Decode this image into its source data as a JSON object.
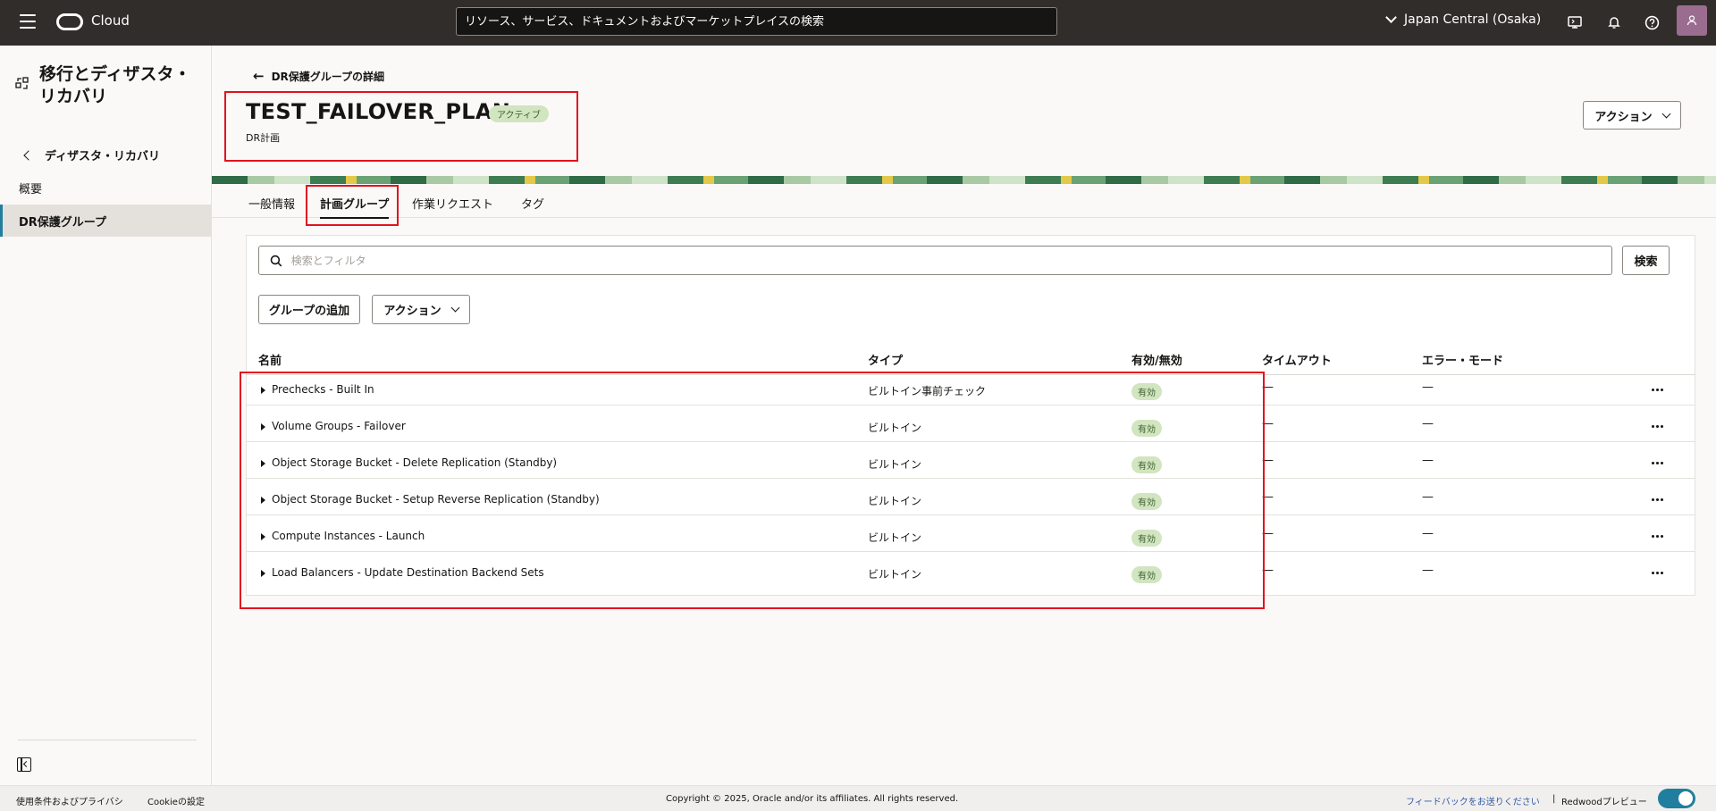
{
  "topbar": {
    "brand": "Cloud",
    "search_placeholder": "リソース、サービス、ドキュメントおよびマーケットプレイスの検索",
    "region": "Japan Central (Osaka)"
  },
  "sidebar": {
    "title": "移行とディザスタ・リカバリ",
    "back_label": "ディザスタ・リカバリ",
    "items": [
      {
        "label": "概要"
      },
      {
        "label": "DR保護グループ"
      }
    ]
  },
  "header": {
    "back_label": "DR保護グループの詳細",
    "title": "TEST_FAILOVER_PLAN",
    "status": "アクティブ",
    "subtitle": "DR計画",
    "actions_label": "アクション"
  },
  "tabs": [
    {
      "label": "一般情報"
    },
    {
      "label": "計画グループ"
    },
    {
      "label": "作業リクエスト"
    },
    {
      "label": "タグ"
    }
  ],
  "toolbar": {
    "filter_placeholder": "検索とフィルタ",
    "search_label": "検索",
    "add_label": "グループの追加",
    "actions_label": "アクション"
  },
  "table": {
    "columns": [
      "名前",
      "タイプ",
      "有効/無効",
      "タイムアウト",
      "エラー・モード"
    ],
    "rows": [
      {
        "name": "Prechecks - Built In",
        "type": "ビルトイン事前チェック",
        "enabled": "有効",
        "timeout": "—",
        "error_mode": "—"
      },
      {
        "name": "Volume Groups - Failover",
        "type": "ビルトイン",
        "enabled": "有効",
        "timeout": "—",
        "error_mode": "—"
      },
      {
        "name": "Object Storage Bucket - Delete Replication (Standby)",
        "type": "ビルトイン",
        "enabled": "有効",
        "timeout": "—",
        "error_mode": "—"
      },
      {
        "name": "Object Storage Bucket - Setup Reverse Replication (Standby)",
        "type": "ビルトイン",
        "enabled": "有効",
        "timeout": "—",
        "error_mode": "—"
      },
      {
        "name": "Compute Instances - Launch",
        "type": "ビルトイン",
        "enabled": "有効",
        "timeout": "—",
        "error_mode": "—"
      },
      {
        "name": "Load Balancers - Update Destination Backend Sets",
        "type": "ビルトイン",
        "enabled": "有効",
        "timeout": "—",
        "error_mode": "—"
      }
    ]
  },
  "footer": {
    "terms": "使用条件およびプライバシ",
    "cookie": "Cookieの設定",
    "copyright": "Copyright © 2025, Oracle and/or its affiliates. All rights reserved.",
    "feedback": "フィードバックをお送りください",
    "separator": "|",
    "redwood": "Redwoodプレビュー"
  },
  "colors": {
    "topbar": "#312d2a",
    "accent": "#227e9e",
    "highlight": "#e0131f",
    "badge_bg": "#d1e5c0"
  }
}
